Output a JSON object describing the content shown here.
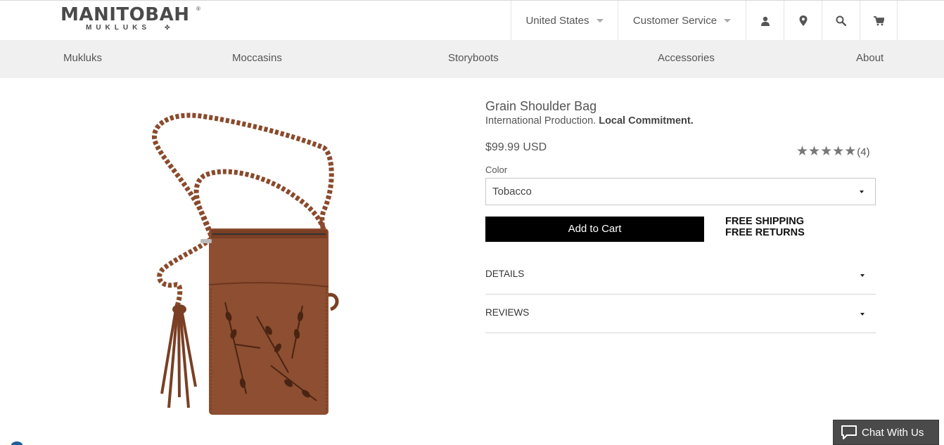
{
  "brand": {
    "name": "MANITOBAH",
    "registered": "®",
    "sub": "MUKLUKS"
  },
  "topbar": {
    "country": "United States",
    "customer_service": "Customer Service",
    "icons": [
      "user-icon",
      "location-pin-icon",
      "search-icon",
      "cart-icon"
    ]
  },
  "nav": {
    "items": [
      {
        "label": "Mukluks"
      },
      {
        "label": "Moccasins"
      },
      {
        "label": "Storyboots"
      },
      {
        "label": "Accessories"
      },
      {
        "label": "About"
      }
    ]
  },
  "product": {
    "title": "Grain Shoulder Bag",
    "tagline_normal": "International Production.",
    "tagline_bold": "Local Commitment.",
    "price": "$99.99 USD",
    "rating": {
      "stars": 5,
      "count_label": "(4)"
    },
    "color_label": "Color",
    "color_value": "Tobacco",
    "add_to_cart": "Add to Cart",
    "shipping_line1": "FREE SHIPPING",
    "shipping_line2": "FREE RETURNS",
    "details_label": "DETAILS",
    "reviews_label": "REVIEWS"
  },
  "chat": {
    "label": "Chat With Us"
  },
  "colors": {
    "nav_bg": "#f0f0f0",
    "button_bg": "#000000",
    "leather": "#8a4a2c",
    "chat_bg": "#4a4a4a"
  }
}
